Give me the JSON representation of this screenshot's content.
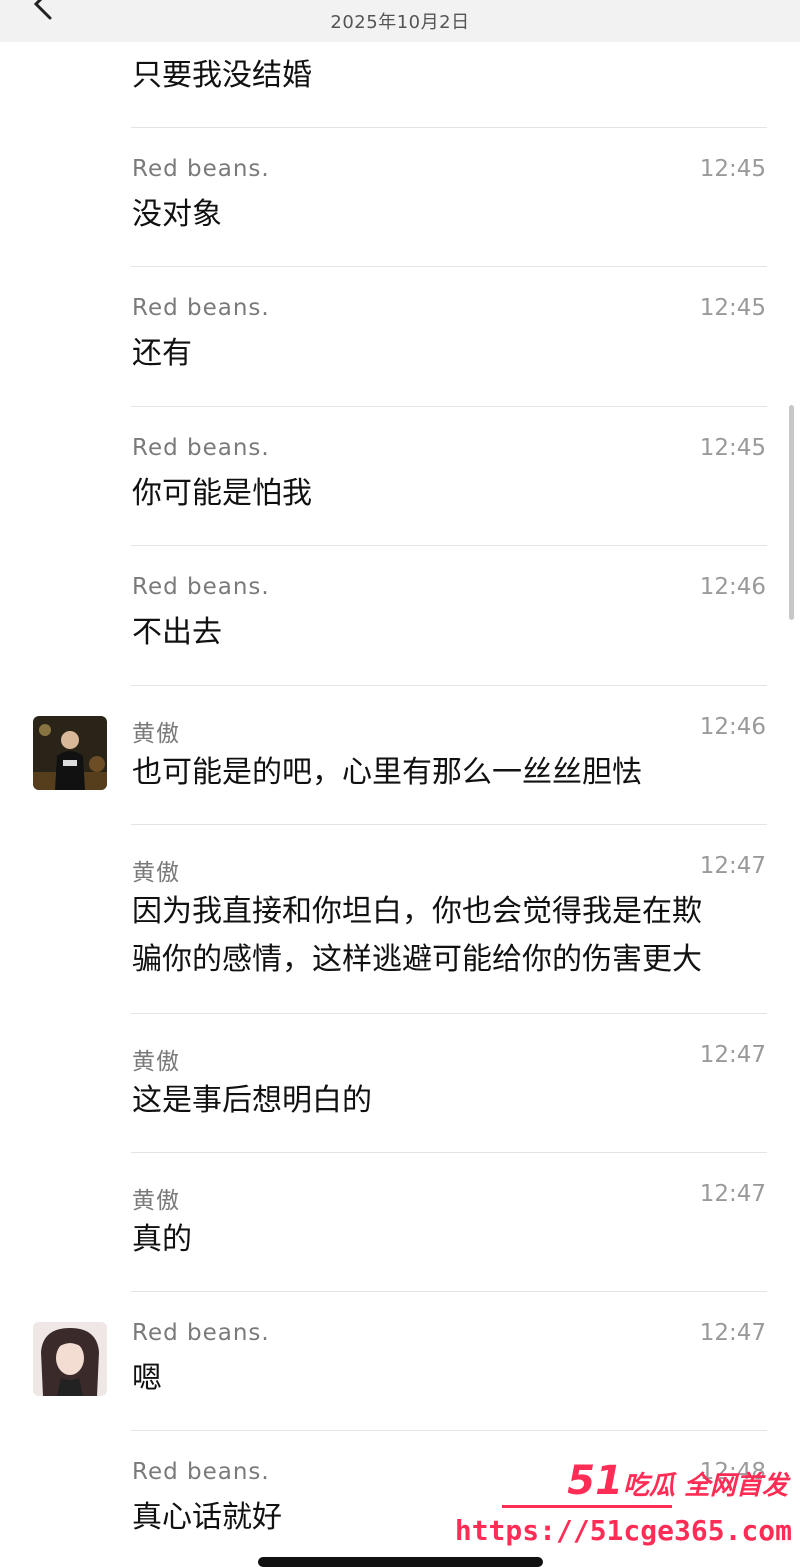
{
  "header": {
    "date": "2025年10月2日"
  },
  "colors": {
    "watermark": "#ff2d55",
    "divider": "#e4e4e4"
  },
  "messages": [
    {
      "text": "只要我没结婚"
    },
    {
      "sender": "Red  beans.",
      "time": "12:45",
      "text": "没对象"
    },
    {
      "sender": "Red  beans.",
      "time": "12:45",
      "text": "还有"
    },
    {
      "sender": "Red  beans.",
      "time": "12:45",
      "text": "你可能是怕我"
    },
    {
      "sender": "Red  beans.",
      "time": "12:46",
      "text": "不出去"
    },
    {
      "sender": "黄傲",
      "time": "12:46",
      "text": "也可能是的吧，心里有那么一丝丝胆怯"
    },
    {
      "sender": "黄傲",
      "time": "12:47",
      "text": "因为我直接和你坦白，你也会觉得我是在欺\n骗你的感情，这样逃避可能给你的伤害更大"
    },
    {
      "sender": "黄傲",
      "time": "12:47",
      "text": "这是事后想明白的"
    },
    {
      "sender": "黄傲",
      "time": "12:47",
      "text": "真的"
    },
    {
      "sender": "Red  beans.",
      "time": "12:47",
      "text": "嗯"
    },
    {
      "sender": "Red  beans.",
      "time": "12:48",
      "text": "真心话就好"
    }
  ],
  "watermark": {
    "number": "51",
    "slogan": "吃瓜 全网首发",
    "url": "https://51cge365.com"
  }
}
